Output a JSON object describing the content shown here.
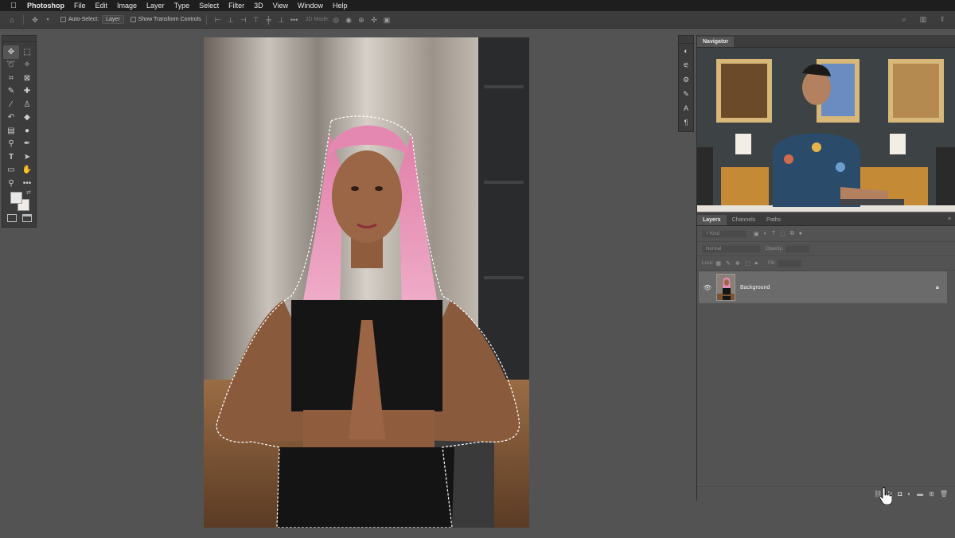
{
  "menubar": {
    "apple_icon": "apple-icon",
    "app_name": "Photoshop",
    "items": [
      "File",
      "Edit",
      "Image",
      "Layer",
      "Type",
      "Select",
      "Filter",
      "3D",
      "View",
      "Window",
      "Help"
    ]
  },
  "options_bar": {
    "auto_select_label": "Auto-Select:",
    "auto_select_value": "Layer",
    "show_transform_label": "Show Transform Controls",
    "mode_3d_label": "3D Mode:"
  },
  "panels": {
    "navigator_tab": "Navigator",
    "layers_tabs": [
      "Layers",
      "Channels",
      "Paths"
    ],
    "filter_kind": "Kind",
    "blend_mode": "Normal",
    "opacity_label": "Opacity:",
    "lock_label": "Lock:",
    "fill_label": "Fill:"
  },
  "layers": [
    {
      "name": "Background",
      "visible": true,
      "locked": true
    }
  ],
  "colors": {
    "foreground": "#e8e8ea",
    "background": "#f2ece8",
    "selection": "#ffffff"
  }
}
